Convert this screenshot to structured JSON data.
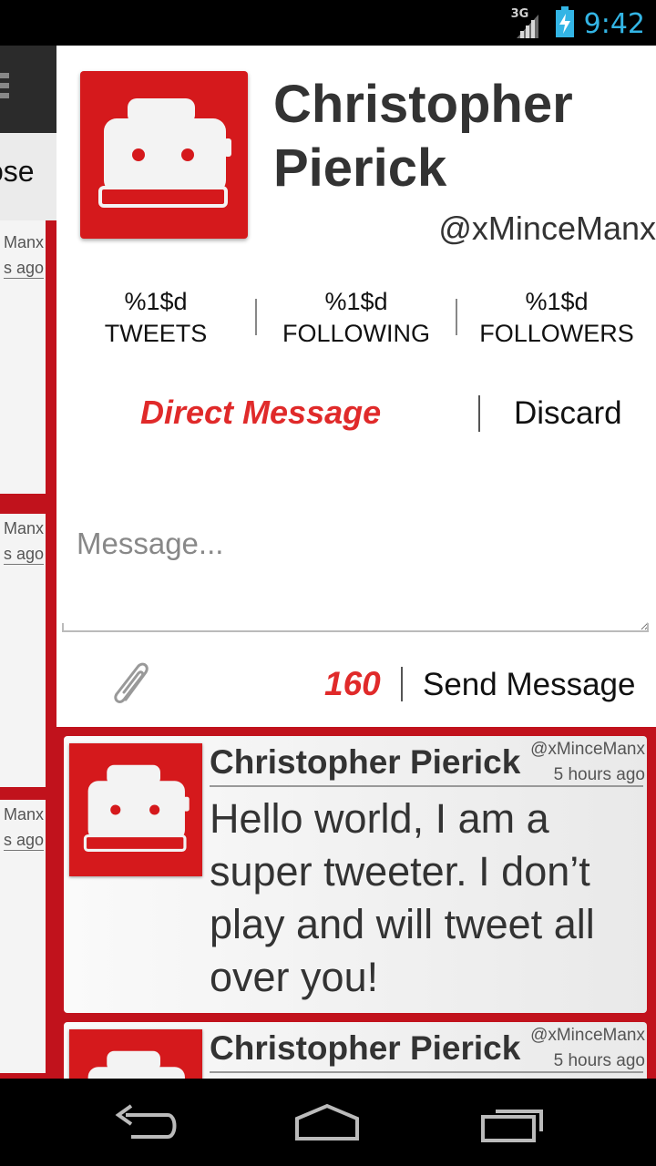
{
  "status_bar": {
    "network": "3G",
    "time": "9:42",
    "colors": {
      "time": "#33b5e5",
      "battery": "#33b5e5"
    },
    "icons": [
      "signal-icon",
      "battery-charging-icon"
    ]
  },
  "background_panel": {
    "close_label": "ose",
    "cards": [
      {
        "handle": "Manx",
        "ago": "s ago"
      },
      {
        "handle": "Manx",
        "ago": "s ago"
      },
      {
        "handle": "Manx",
        "ago": "s ago"
      }
    ]
  },
  "profile": {
    "name_line1": "Christopher",
    "name_line2": "Pierick",
    "handle": "@xMinceManx",
    "stats": [
      {
        "value": "%1$d",
        "label": "TWEETS"
      },
      {
        "value": "%1$d",
        "label": "FOLLOWING"
      },
      {
        "value": "%1$d",
        "label": "FOLLOWERS"
      }
    ]
  },
  "compose": {
    "title": "Direct Message",
    "discard_label": "Discard",
    "placeholder": "Message...",
    "char_count": "160",
    "send_label": "Send Message",
    "colors": {
      "accent": "#e02a2a"
    }
  },
  "tweets": [
    {
      "name": "Christopher Pierick",
      "handle": "@xMinceManx",
      "time": "5 hours ago",
      "text": "Hello world, I am a super tweeter. I don’t play and will tweet all over you!"
    },
    {
      "name": "Christopher Pierick",
      "handle": "@xMinceManx",
      "time": "5 hours ago",
      "text": ""
    }
  ],
  "nav": {
    "icons": [
      "back-icon",
      "home-icon",
      "recent-apps-icon"
    ]
  },
  "colors": {
    "brand_red": "#c1121c",
    "avatar_red": "#d5191c"
  }
}
